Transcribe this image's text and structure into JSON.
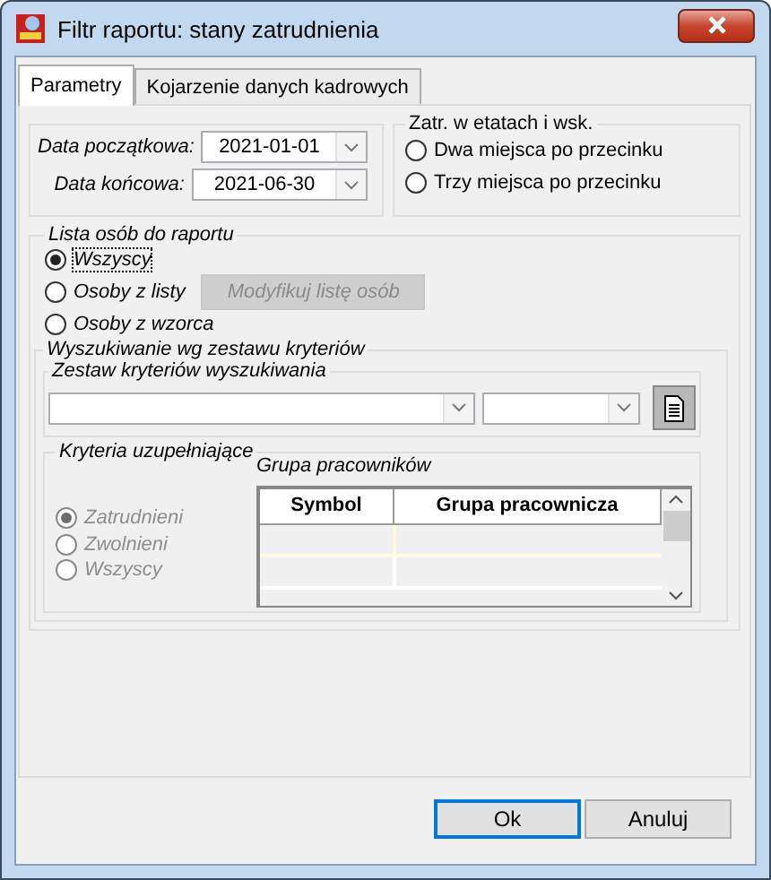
{
  "window": {
    "title": "Filtr raportu: stany zatrudnienia"
  },
  "tabs": [
    {
      "label": "Parametry",
      "selected": true
    },
    {
      "label": "Kojarzenie danych kadrowych",
      "selected": false
    }
  ],
  "dates": [
    {
      "label": "Data początkowa:",
      "value": "2021-01-01"
    },
    {
      "label": "Data końcowa:",
      "value": "2021-06-30"
    }
  ],
  "precision": {
    "title": "Zatr. w etatach i wsk.",
    "options": [
      {
        "label": "Dwa miejsca po przecinku",
        "selected": false
      },
      {
        "label": "Trzy miejsca po przecinku",
        "selected": false
      }
    ]
  },
  "person_list": {
    "title": "Lista osób do raportu",
    "options": [
      {
        "label": "Wszyscy",
        "selected": true,
        "focused": true
      },
      {
        "label": "Osoby z listy",
        "selected": false,
        "focused": false
      },
      {
        "label": "Osoby z wzorca",
        "selected": false,
        "focused": false
      }
    ],
    "modify_button": {
      "label": "Modyfikuj listę osób",
      "disabled": true
    }
  },
  "criteria_search": {
    "title": "Wyszukiwanie wg zestawu kryteriów",
    "set_title": "Zestaw kryteriów wyszukiwania"
  },
  "supplementary": {
    "title": "Kryteria uzupełniające",
    "disabled": true,
    "options": [
      {
        "label": "Zatrudnieni",
        "selected": true
      },
      {
        "label": "Zwolnieni",
        "selected": false
      },
      {
        "label": "Wszyscy",
        "selected": false
      }
    ],
    "group_table": {
      "title": "Grupa pracowników",
      "columns": [
        "Symbol",
        "Grupa pracownicza"
      ]
    }
  },
  "buttons": [
    {
      "label": "Ok",
      "default": true
    },
    {
      "label": "Anuluj",
      "default": false
    }
  ]
}
